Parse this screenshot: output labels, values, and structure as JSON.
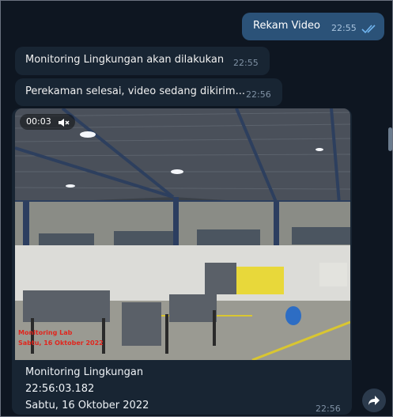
{
  "chat": {
    "outgoing": {
      "text": "Rekam Video",
      "time": "22:55",
      "status_icon": "double-check-icon"
    },
    "incoming": [
      {
        "text": "Monitoring Lingkungan akan dilakukan",
        "time": "22:55"
      },
      {
        "text": "Perekaman selesai, video sedang dikirim...",
        "time": "22:56"
      }
    ],
    "video_message": {
      "duration": "00:03",
      "mute_icon": "muted-speaker-icon",
      "stamp_line1": "Monitoring Lab",
      "stamp_line2": "Sabtu, 16 Oktober 2022",
      "caption_line1": "Monitoring Lingkungan",
      "caption_line2": "22:56:03.182",
      "caption_line3": "Sabtu, 16 Oktober 2022",
      "time": "22:56"
    },
    "forward_icon": "forward-arrow-icon"
  },
  "colors": {
    "background": "#0e1621",
    "incoming_bubble": "#182533",
    "outgoing_bubble": "#2b5278",
    "accent": "#53a6e8"
  }
}
